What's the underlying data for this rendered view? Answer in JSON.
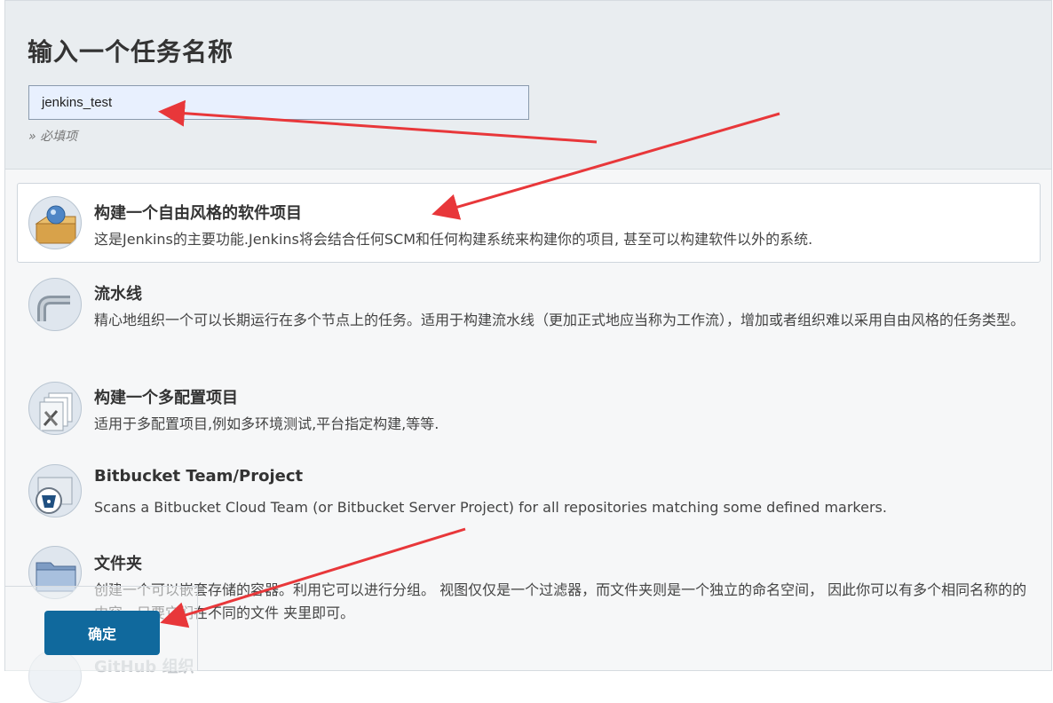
{
  "header": {
    "title": "输入一个任务名称",
    "job_name_value": "jenkins_test",
    "required_hint": "» 必填项"
  },
  "job_types": [
    {
      "title": "构建一个自由风格的软件项目",
      "description": "这是Jenkins的主要功能.Jenkins将会结合任何SCM和任何构建系统来构建你的项目, 甚至可以构建软件以外的系统.",
      "icon": "freestyle-box-icon",
      "selected": true
    },
    {
      "title": "流水线",
      "description": "精心地组织一个可以长期运行在多个节点上的任务。适用于构建流水线（更加正式地应当称为工作流），增加或者组织难以采用自由风格的任务类型。",
      "icon": "pipeline-icon",
      "selected": false
    },
    {
      "title": "构建一个多配置项目",
      "description": "适用于多配置项目,例如多环境测试,平台指定构建,等等.",
      "icon": "multi-config-icon",
      "selected": false
    },
    {
      "title": "Bitbucket Team/Project",
      "description": "Scans a Bitbucket Cloud Team (or Bitbucket Server Project) for all repositories matching some defined markers.",
      "icon": "bitbucket-icon",
      "selected": false
    },
    {
      "title": "文件夹",
      "description": "创建一个可以嵌套存储的容器。利用它可以进行分组。 视图仅仅是一个过滤器，而文件夹则是一个独立的命名空间， 因此你可以有多个相同名称的的内容，只要它们在不同的文件 夹里即可。",
      "icon": "folder-icon",
      "selected": false
    },
    {
      "title": "GitHub 组织",
      "description": "",
      "icon": "github-icon",
      "selected": false
    }
  ],
  "footer": {
    "ok_label": "确定"
  },
  "colors": {
    "accent": "#10699d",
    "annotation_arrow": "#e8373a",
    "header_bg": "#e9edf0"
  }
}
